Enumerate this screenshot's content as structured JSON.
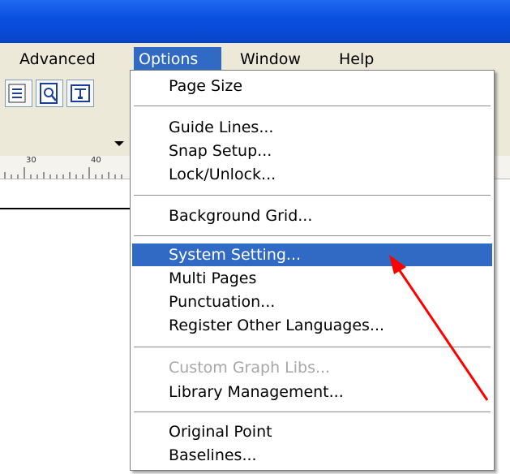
{
  "menubar": {
    "items": [
      {
        "label": "Advanced",
        "active": false
      },
      {
        "label": "Options",
        "active": true
      },
      {
        "label": "Window",
        "active": false
      },
      {
        "label": "Help",
        "active": false
      }
    ]
  },
  "toolbar": {
    "icons": [
      "print-preview-icon",
      "zoom-page-icon",
      "text-frame-icon"
    ]
  },
  "ruler": {
    "labels": [
      "30",
      "40"
    ]
  },
  "options_menu": {
    "items": [
      {
        "label": "Page Size"
      },
      {
        "label": "Guide Lines..."
      },
      {
        "label": "Snap Setup..."
      },
      {
        "label": "Lock/Unlock..."
      },
      {
        "label": "Background Grid..."
      },
      {
        "label": "System Setting...",
        "selected": true
      },
      {
        "label": "Multi Pages"
      },
      {
        "label": "Punctuation..."
      },
      {
        "label": "Register Other Languages..."
      },
      {
        "label": "Custom Graph Libs...",
        "disabled": true
      },
      {
        "label": "Library Management..."
      },
      {
        "label": "Original Point"
      },
      {
        "label": "Baselines..."
      }
    ]
  },
  "annotation": {
    "arrow_color": "#ff0000"
  },
  "colors": {
    "titlebar": "#0a4fe0",
    "highlight": "#316ac5",
    "menubar": "#ece9d8",
    "disabled_text": "#a7a7a7"
  }
}
